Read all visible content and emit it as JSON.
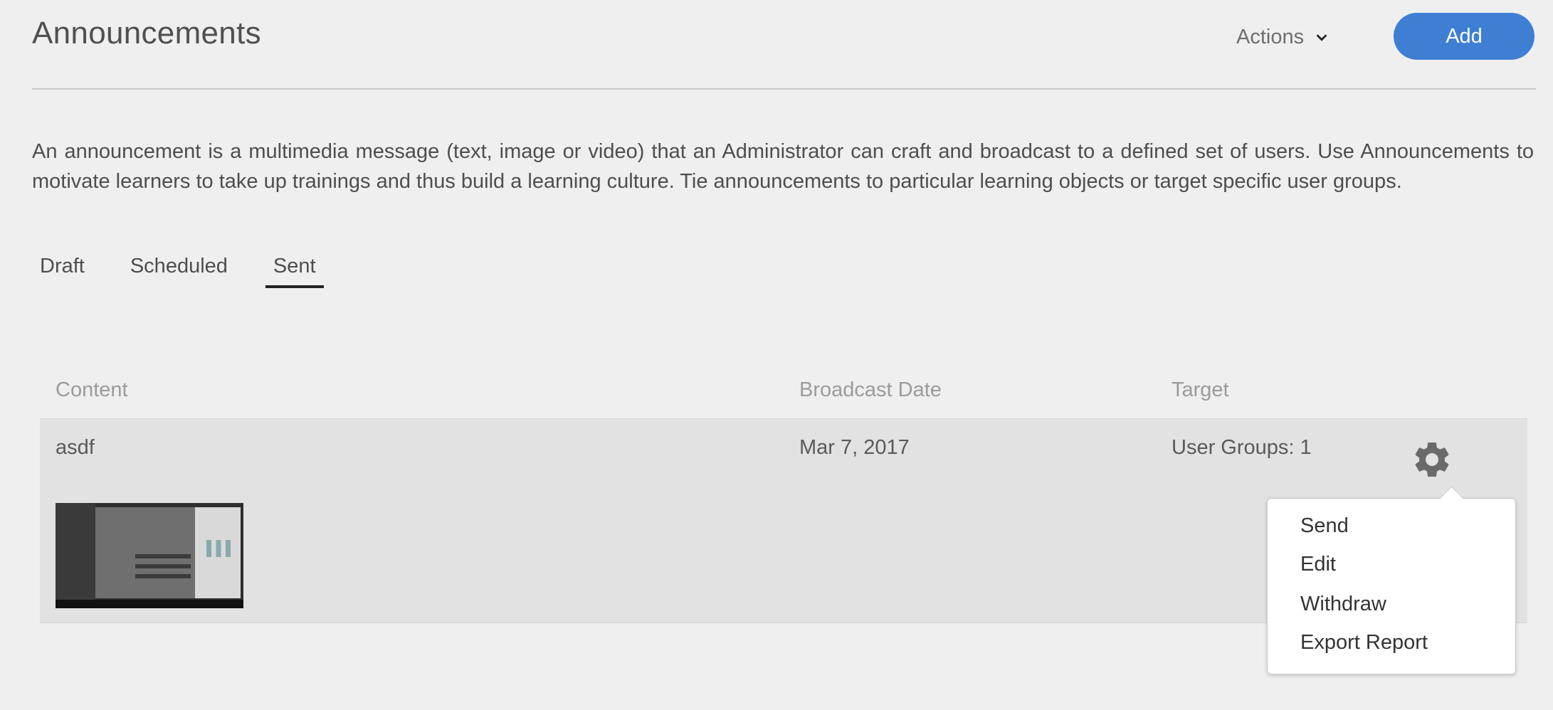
{
  "page": {
    "title": "Announcements",
    "actions_label": "Actions",
    "add_label": "Add",
    "description": "An announcement is a multimedia message (text, image or video) that an Administrator can craft and broadcast to a defined set of users. Use Announcements to motivate learners to take up trainings and thus build a learning culture. Tie announcements to particular learning objects or target specific user groups."
  },
  "tabs": [
    {
      "label": "Draft",
      "active": false
    },
    {
      "label": "Scheduled",
      "active": false
    },
    {
      "label": "Sent",
      "active": true
    }
  ],
  "table": {
    "headers": [
      "Content",
      "Broadcast Date",
      "Target"
    ],
    "rows": [
      {
        "content": "asdf",
        "broadcast_date": "Mar 7, 2017",
        "target": "User Groups: 1"
      }
    ]
  },
  "context_menu": {
    "items": [
      "Send",
      "Edit",
      "Withdraw",
      "Export Report"
    ]
  },
  "icons": {
    "actions": "chevron-down-icon",
    "row_settings": "gear-icon"
  },
  "colors": {
    "accent": "#3e7fd4",
    "background": "#efefef",
    "row_background": "#e2e2e2"
  }
}
